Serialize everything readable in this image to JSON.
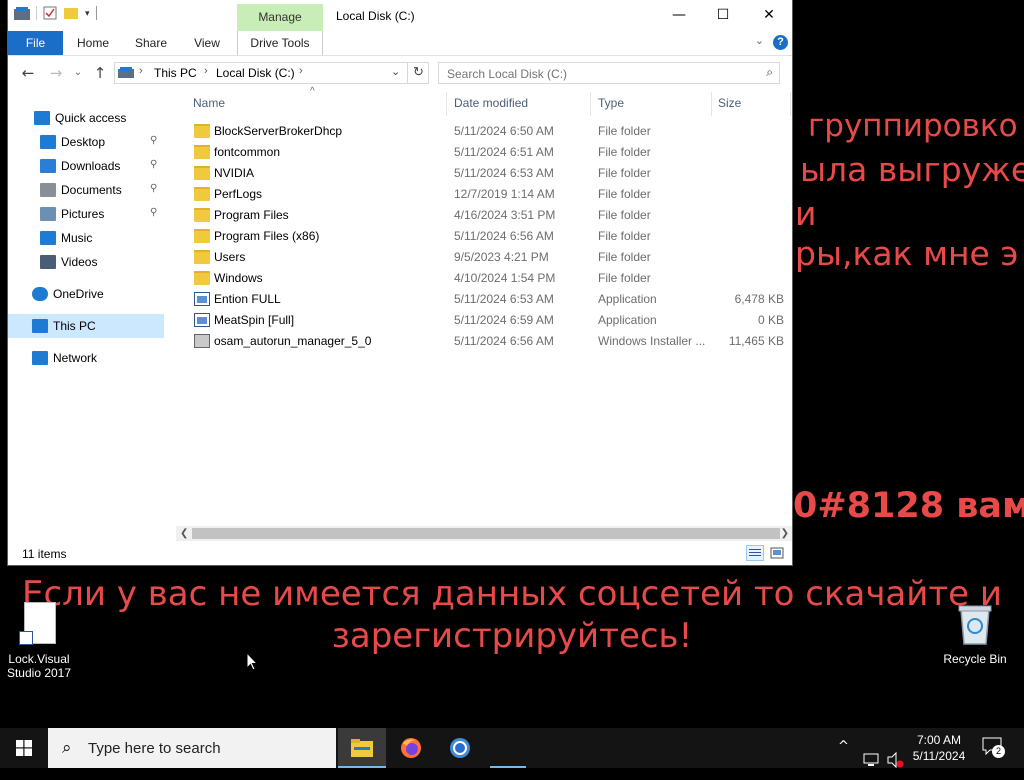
{
  "desktop": {
    "background_text": [
      "группировко",
      "ыла выгруже",
      "и",
      "ры,как мне э",
      "0#8128 вам",
      "Если у вас не имеется данных соцсетей то скачайте и",
      "зарегистрируйтесь!"
    ],
    "icons": [
      {
        "label": "Lock.Visual Studio 2017",
        "icon": "file-icon"
      },
      {
        "label": "Recycle Bin",
        "icon": "recycle-bin-icon"
      }
    ]
  },
  "window": {
    "title": "Local Disk (C:)",
    "contextual_tab": "Manage",
    "ribbon_tabs": [
      "File",
      "Home",
      "Share",
      "View",
      "Drive Tools"
    ],
    "controls": {
      "minimize": "—",
      "maximize": "☐",
      "close": "✕"
    }
  },
  "address": {
    "crumbs": [
      "This PC",
      "Local Disk (C:)"
    ],
    "search_placeholder": "Search Local Disk (C:)"
  },
  "nav_pane": [
    {
      "label": "Quick access",
      "icon": "star-icon",
      "pinned": false,
      "selected": false
    },
    {
      "label": "Desktop",
      "icon": "desktop-icon",
      "pinned": true,
      "selected": false
    },
    {
      "label": "Downloads",
      "icon": "download-icon",
      "pinned": true,
      "selected": false
    },
    {
      "label": "Documents",
      "icon": "document-icon",
      "pinned": true,
      "selected": false
    },
    {
      "label": "Pictures",
      "icon": "picture-icon",
      "pinned": true,
      "selected": false
    },
    {
      "label": "Music",
      "icon": "music-icon",
      "pinned": false,
      "selected": false
    },
    {
      "label": "Videos",
      "icon": "video-icon",
      "pinned": false,
      "selected": false
    },
    {
      "label": "OneDrive",
      "icon": "cloud-icon",
      "pinned": false,
      "selected": false
    },
    {
      "label": "This PC",
      "icon": "computer-icon",
      "pinned": false,
      "selected": true
    },
    {
      "label": "Network",
      "icon": "network-icon",
      "pinned": false,
      "selected": false
    }
  ],
  "columns": [
    "Name",
    "Date modified",
    "Type",
    "Size"
  ],
  "files": [
    {
      "name": "BlockServerBrokerDhcp",
      "date": "5/11/2024 6:50 AM",
      "type": "File folder",
      "size": "",
      "kind": "folder"
    },
    {
      "name": "fontcommon",
      "date": "5/11/2024 6:51 AM",
      "type": "File folder",
      "size": "",
      "kind": "folder"
    },
    {
      "name": "NVIDIA",
      "date": "5/11/2024 6:53 AM",
      "type": "File folder",
      "size": "",
      "kind": "folder"
    },
    {
      "name": "PerfLogs",
      "date": "12/7/2019 1:14 AM",
      "type": "File folder",
      "size": "",
      "kind": "folder"
    },
    {
      "name": "Program Files",
      "date": "4/16/2024 3:51 PM",
      "type": "File folder",
      "size": "",
      "kind": "folder"
    },
    {
      "name": "Program Files (x86)",
      "date": "5/11/2024 6:56 AM",
      "type": "File folder",
      "size": "",
      "kind": "folder"
    },
    {
      "name": "Users",
      "date": "9/5/2023 4:21 PM",
      "type": "File folder",
      "size": "",
      "kind": "folder"
    },
    {
      "name": "Windows",
      "date": "4/10/2024 1:54 PM",
      "type": "File folder",
      "size": "",
      "kind": "folder"
    },
    {
      "name": "Ention FULL",
      "date": "5/11/2024 6:53 AM",
      "type": "Application",
      "size": "6,478 KB",
      "kind": "app"
    },
    {
      "name": "MeatSpin [Full]",
      "date": "5/11/2024 6:59 AM",
      "type": "Application",
      "size": "0 KB",
      "kind": "app"
    },
    {
      "name": "osam_autorun_manager_5_0",
      "date": "5/11/2024 6:56 AM",
      "type": "Windows Installer ...",
      "size": "11,465 KB",
      "kind": "msi"
    }
  ],
  "status": {
    "item_count": "11 items"
  },
  "taskbar": {
    "search_placeholder": "Type here to search",
    "apps": [
      "file-explorer-icon",
      "firefox-icon",
      "chrome-icon"
    ],
    "clock_time": "7:00 AM",
    "clock_date": "5/11/2024",
    "notification_count": "2"
  },
  "colors": {
    "accent": "#1a6ec8",
    "manage_tab": "#c8edb6",
    "desktop_text": "#e84a4a",
    "selection": "#cce8ff"
  }
}
